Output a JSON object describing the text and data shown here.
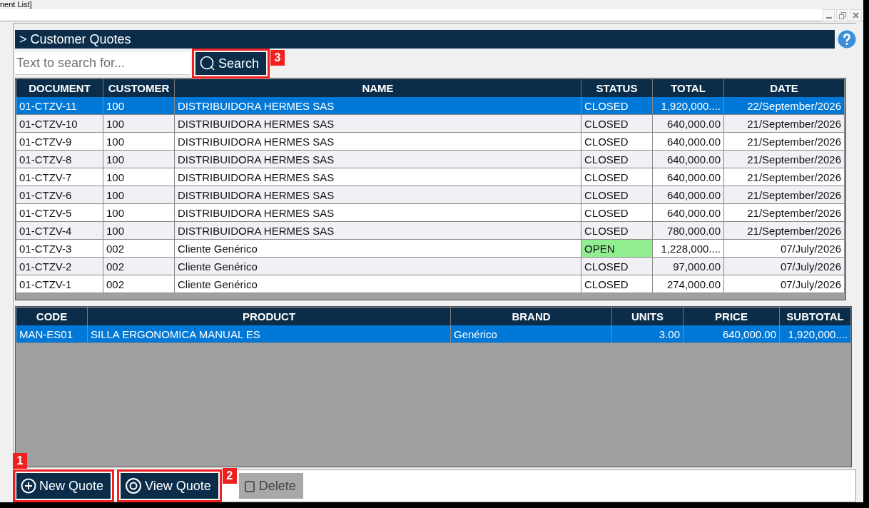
{
  "window": {
    "title": "nent List]"
  },
  "panel": {
    "title": "> Customer Quotes"
  },
  "search": {
    "placeholder": "Text to search for...",
    "button": "Search",
    "callout": "3"
  },
  "quotes": {
    "columns": [
      "DOCUMENT",
      "CUSTOMER",
      "NAME",
      "STATUS",
      "TOTAL",
      "DATE"
    ],
    "rows": [
      {
        "document": "01-CTZV-11",
        "customer": "100",
        "name": "DISTRIBUIDORA HERMES SAS",
        "status": "CLOSED",
        "open": false,
        "total": "1,920,000....",
        "date": "22/September/2026",
        "selected": true
      },
      {
        "document": "01-CTZV-10",
        "customer": "100",
        "name": "DISTRIBUIDORA HERMES SAS",
        "status": "CLOSED",
        "open": false,
        "total": "640,000.00",
        "date": "21/September/2026",
        "selected": false
      },
      {
        "document": "01-CTZV-9",
        "customer": "100",
        "name": "DISTRIBUIDORA HERMES SAS",
        "status": "CLOSED",
        "open": false,
        "total": "640,000.00",
        "date": "21/September/2026",
        "selected": false
      },
      {
        "document": "01-CTZV-8",
        "customer": "100",
        "name": "DISTRIBUIDORA HERMES SAS",
        "status": "CLOSED",
        "open": false,
        "total": "640,000.00",
        "date": "21/September/2026",
        "selected": false
      },
      {
        "document": "01-CTZV-7",
        "customer": "100",
        "name": "DISTRIBUIDORA HERMES SAS",
        "status": "CLOSED",
        "open": false,
        "total": "640,000.00",
        "date": "21/September/2026",
        "selected": false
      },
      {
        "document": "01-CTZV-6",
        "customer": "100",
        "name": "DISTRIBUIDORA HERMES SAS",
        "status": "CLOSED",
        "open": false,
        "total": "640,000.00",
        "date": "21/September/2026",
        "selected": false
      },
      {
        "document": "01-CTZV-5",
        "customer": "100",
        "name": "DISTRIBUIDORA HERMES SAS",
        "status": "CLOSED",
        "open": false,
        "total": "640,000.00",
        "date": "21/September/2026",
        "selected": false
      },
      {
        "document": "01-CTZV-4",
        "customer": "100",
        "name": "DISTRIBUIDORA HERMES SAS",
        "status": "CLOSED",
        "open": false,
        "total": "780,000.00",
        "date": "21/September/2026",
        "selected": false
      },
      {
        "document": "01-CTZV-3",
        "customer": "002",
        "name": "Cliente Genérico",
        "status": "OPEN",
        "open": true,
        "total": "1,228,000....",
        "date": "07/July/2026",
        "selected": false
      },
      {
        "document": "01-CTZV-2",
        "customer": "002",
        "name": "Cliente Genérico",
        "status": "CLOSED",
        "open": false,
        "total": "97,000.00",
        "date": "07/July/2026",
        "selected": false
      },
      {
        "document": "01-CTZV-1",
        "customer": "002",
        "name": "Cliente Genérico",
        "status": "CLOSED",
        "open": false,
        "total": "274,000.00",
        "date": "07/July/2026",
        "selected": false
      }
    ]
  },
  "items": {
    "columns": [
      "CODE",
      "PRODUCT",
      "BRAND",
      "UNITS",
      "PRICE",
      "SUBTOTAL"
    ],
    "rows": [
      {
        "code": "MAN-ES01",
        "product": "SILLA ERGONOMICA MANUAL ES",
        "brand": "Genérico",
        "units": "3.00",
        "price": "640,000.00",
        "subtotal": "1,920,000....",
        "selected": true
      }
    ]
  },
  "buttons": [
    {
      "kind": "new",
      "label": "New Quote",
      "disabled": false,
      "callout": "1"
    },
    {
      "kind": "view",
      "label": "View Quote",
      "disabled": false,
      "callout": "2"
    },
    {
      "kind": "delete",
      "label": "Delete",
      "disabled": true
    }
  ]
}
